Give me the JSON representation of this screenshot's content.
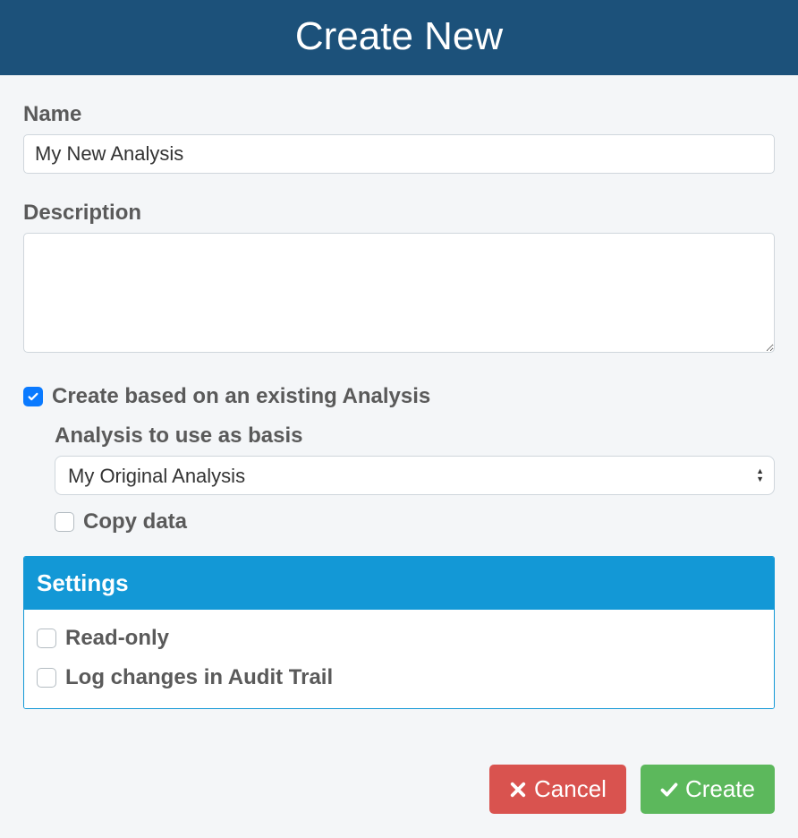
{
  "header": {
    "title": "Create New"
  },
  "form": {
    "name_label": "Name",
    "name_value": "My New Analysis",
    "description_label": "Description",
    "description_value": "",
    "based_on_existing": {
      "label": "Create based on an existing Analysis",
      "checked": true,
      "basis_label": "Analysis to use as basis",
      "basis_selected": "My Original Analysis",
      "copy_data_label": "Copy data",
      "copy_data_checked": false
    }
  },
  "settings": {
    "title": "Settings",
    "read_only": {
      "label": "Read-only",
      "checked": false
    },
    "audit_trail": {
      "label": "Log changes in Audit Trail",
      "checked": false
    }
  },
  "buttons": {
    "cancel": "Cancel",
    "create": "Create"
  }
}
